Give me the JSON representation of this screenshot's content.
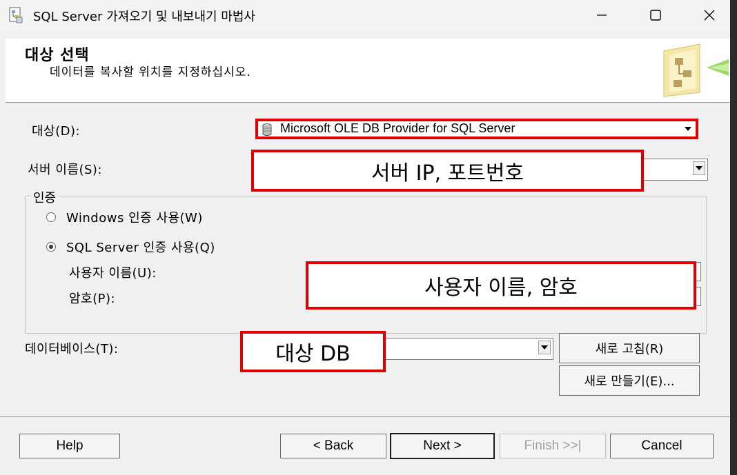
{
  "window": {
    "title": "SQL Server 가져오기 및 내보내기 마법사",
    "minimize_icon": "minimize-icon",
    "maximize_icon": "maximize-icon",
    "close_icon": "close-icon"
  },
  "header": {
    "title": "대상 선택",
    "subtitle": "데이터를 복사할 위치를 지정하십시오."
  },
  "form": {
    "destination_label": "대상(D):",
    "destination_value": "Microsoft OLE DB Provider for SQL Server",
    "server_label": "서버 이름(S):",
    "auth_group_label": "인증",
    "windows_auth_label": "Windows 인증 사용(W)",
    "sql_auth_label": "SQL Server 인증 사용(Q)",
    "selected_auth": "sql",
    "username_label": "사용자 이름(U):",
    "password_label": "암호(P):",
    "database_label": "데이터베이스(T):",
    "refresh_button": "새로 고침(R)",
    "new_button": "새로 만들기(E)..."
  },
  "annotations": {
    "server": "서버 IP, 포트번호",
    "credentials": "사용자 이름, 암호",
    "database": "대상 DB",
    "highlight_color": "#e00000"
  },
  "footer": {
    "help": "Help",
    "back": "< Back",
    "next": "Next >",
    "finish": "Finish >>|",
    "cancel": "Cancel"
  }
}
